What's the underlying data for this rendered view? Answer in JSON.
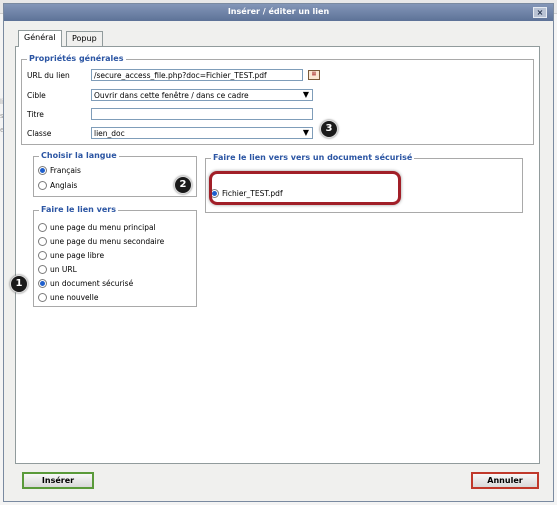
{
  "background": {
    "side_texts": [
      "liu",
      "s c",
      "ert"
    ]
  },
  "dialog": {
    "title": "Insérer / éditer un lien",
    "close_label": "×"
  },
  "tabs": [
    {
      "label": "Général",
      "active": true
    },
    {
      "label": "Popup",
      "active": false
    }
  ],
  "general_props": {
    "legend": "Propriétés générales",
    "url_label": "URL du lien",
    "url_value": "/secure_access_file.php?doc=Fichier_TEST.pdf",
    "target_label": "Cible",
    "target_value": "Ouvrir dans cette fenêtre / dans ce cadre",
    "title_label": "Titre",
    "title_value": "",
    "class_label": "Classe",
    "class_value": "lien_doc"
  },
  "language": {
    "legend": "Choisir la langue",
    "options": [
      {
        "label": "Français",
        "checked": true
      },
      {
        "label": "Anglais",
        "checked": false
      }
    ]
  },
  "link_to": {
    "legend": "Faire le lien vers",
    "options": [
      {
        "label": "une page du menu principal",
        "checked": false
      },
      {
        "label": "une page du menu secondaire",
        "checked": false
      },
      {
        "label": "une page libre",
        "checked": false
      },
      {
        "label": "un URL",
        "checked": false
      },
      {
        "label": "un document sécurisé",
        "checked": true
      },
      {
        "label": "une nouvelle",
        "checked": false
      }
    ]
  },
  "secure_doc": {
    "legend": "Faire le lien vers vers un document sécurisé",
    "file": {
      "label": "Fichier_TEST.pdf",
      "checked": true
    }
  },
  "buttons": {
    "insert": "Insérer",
    "cancel": "Annuler"
  },
  "callouts": [
    "1",
    "2",
    "3"
  ],
  "colors": {
    "legend": "#2b55a3",
    "title_bar": "#5d7297",
    "highlight": "#a11f28",
    "insert_border": "#5a9a3a",
    "cancel_border": "#c0392b"
  }
}
